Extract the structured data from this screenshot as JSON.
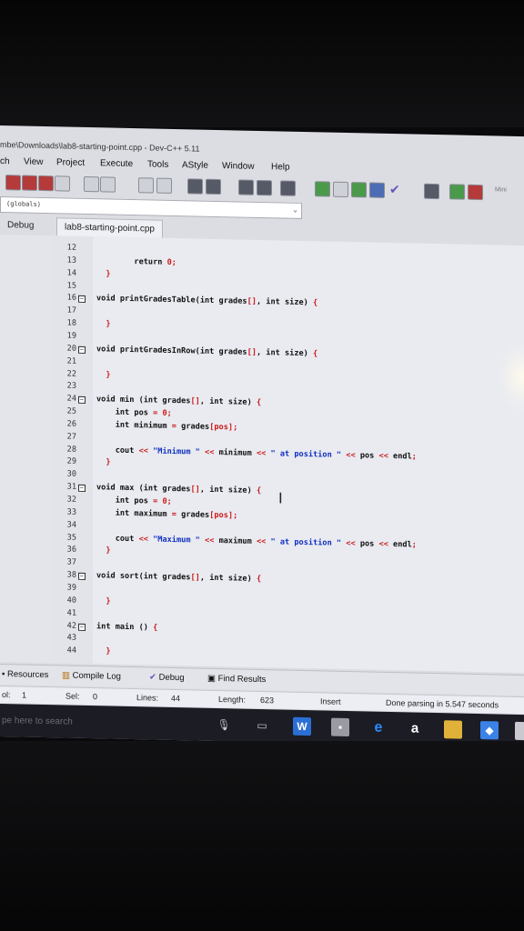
{
  "window": {
    "title": "mbe\\Downloads\\lab8-starting-point.cpp - Dev-C++ 5.11"
  },
  "menu": [
    "ch",
    "View",
    "Project",
    "Execute",
    "Tools",
    "AStyle",
    "Window",
    "Help"
  ],
  "toolbar": {
    "scope_combo": "(globals)",
    "right_label": "Mini"
  },
  "tabs": {
    "left": "Debug",
    "file": "lab8-starting-point.cpp"
  },
  "code": [
    {
      "n": "12",
      "fold": "",
      "parts": []
    },
    {
      "n": "13",
      "fold": "",
      "parts": [
        [
          "kw",
          "        return "
        ],
        [
          "num",
          "0"
        ],
        [
          "sym",
          ";"
        ]
      ]
    },
    {
      "n": "14",
      "fold": "",
      "parts": [
        [
          "sym",
          "  }"
        ]
      ]
    },
    {
      "n": "15",
      "fold": "",
      "parts": []
    },
    {
      "n": "16",
      "fold": "⊟",
      "parts": [
        [
          "kw",
          "void printGradesTable(int grades"
        ],
        [
          "sym",
          "[]"
        ],
        [
          "kw",
          ", int size) "
        ],
        [
          "sym",
          "{"
        ]
      ]
    },
    {
      "n": "17",
      "fold": "",
      "parts": []
    },
    {
      "n": "18",
      "fold": "",
      "parts": [
        [
          "sym",
          "  }"
        ]
      ]
    },
    {
      "n": "19",
      "fold": "",
      "parts": []
    },
    {
      "n": "20",
      "fold": "⊟",
      "parts": [
        [
          "kw",
          "void printGradesInRow(int grades"
        ],
        [
          "sym",
          "[]"
        ],
        [
          "kw",
          ", int size) "
        ],
        [
          "sym",
          "{"
        ]
      ]
    },
    {
      "n": "21",
      "fold": "",
      "parts": []
    },
    {
      "n": "22",
      "fold": "",
      "parts": [
        [
          "sym",
          "  }"
        ]
      ]
    },
    {
      "n": "23",
      "fold": "",
      "parts": []
    },
    {
      "n": "24",
      "fold": "⊟",
      "parts": [
        [
          "kw",
          "void min (int grades"
        ],
        [
          "sym",
          "[]"
        ],
        [
          "kw",
          ", int size) "
        ],
        [
          "sym",
          "{"
        ]
      ]
    },
    {
      "n": "25",
      "fold": "",
      "parts": [
        [
          "kw",
          "    int pos "
        ],
        [
          "sym",
          "= "
        ],
        [
          "num",
          "0"
        ],
        [
          "sym",
          ";"
        ]
      ]
    },
    {
      "n": "26",
      "fold": "",
      "parts": [
        [
          "kw",
          "    int minimum "
        ],
        [
          "sym",
          "= "
        ],
        [
          "kw",
          "grades"
        ],
        [
          "sym",
          "[pos];"
        ]
      ]
    },
    {
      "n": "27",
      "fold": "",
      "parts": []
    },
    {
      "n": "28",
      "fold": "",
      "parts": [
        [
          "kw",
          "    cout "
        ],
        [
          "sym",
          "<< "
        ],
        [
          "str",
          "\"Minimum \""
        ],
        [
          "sym",
          " << "
        ],
        [
          "kw",
          "minimum "
        ],
        [
          "sym",
          "<< "
        ],
        [
          "str",
          "\" at position \""
        ],
        [
          "sym",
          " << "
        ],
        [
          "kw",
          "pos "
        ],
        [
          "sym",
          "<< "
        ],
        [
          "kw",
          "endl"
        ],
        [
          "sym",
          ";"
        ]
      ]
    },
    {
      "n": "29",
      "fold": "",
      "parts": [
        [
          "sym",
          "  }"
        ]
      ]
    },
    {
      "n": "30",
      "fold": "",
      "parts": []
    },
    {
      "n": "31",
      "fold": "⊟",
      "parts": [
        [
          "kw",
          "void max (int grades"
        ],
        [
          "sym",
          "[]"
        ],
        [
          "kw",
          ", int size) "
        ],
        [
          "sym",
          "{"
        ]
      ]
    },
    {
      "n": "32",
      "fold": "",
      "parts": [
        [
          "kw",
          "    int pos "
        ],
        [
          "sym",
          "= "
        ],
        [
          "num",
          "0"
        ],
        [
          "sym",
          ";"
        ]
      ]
    },
    {
      "n": "33",
      "fold": "",
      "parts": [
        [
          "kw",
          "    int maximum "
        ],
        [
          "sym",
          "= "
        ],
        [
          "kw",
          "grades"
        ],
        [
          "sym",
          "[pos];"
        ]
      ]
    },
    {
      "n": "34",
      "fold": "",
      "parts": []
    },
    {
      "n": "35",
      "fold": "",
      "parts": [
        [
          "kw",
          "    cout "
        ],
        [
          "sym",
          "<< "
        ],
        [
          "str",
          "\"Maximum \""
        ],
        [
          "sym",
          " << "
        ],
        [
          "kw",
          "maximum "
        ],
        [
          "sym",
          "<< "
        ],
        [
          "str",
          "\" at position \""
        ],
        [
          "sym",
          " << "
        ],
        [
          "kw",
          "pos "
        ],
        [
          "sym",
          "<< "
        ],
        [
          "kw",
          "endl"
        ],
        [
          "sym",
          ";"
        ]
      ]
    },
    {
      "n": "36",
      "fold": "",
      "parts": [
        [
          "sym",
          "  }"
        ]
      ]
    },
    {
      "n": "37",
      "fold": "",
      "parts": []
    },
    {
      "n": "38",
      "fold": "⊟",
      "parts": [
        [
          "kw",
          "void sort(int grades"
        ],
        [
          "sym",
          "[]"
        ],
        [
          "kw",
          ", int size) "
        ],
        [
          "sym",
          "{"
        ]
      ]
    },
    {
      "n": "39",
      "fold": "",
      "parts": []
    },
    {
      "n": "40",
      "fold": "",
      "parts": [
        [
          "sym",
          "  }"
        ]
      ]
    },
    {
      "n": "41",
      "fold": "",
      "parts": []
    },
    {
      "n": "42",
      "fold": "⊟",
      "parts": [
        [
          "kw",
          "int main () "
        ],
        [
          "sym",
          "{"
        ]
      ]
    },
    {
      "n": "43",
      "fold": "",
      "parts": []
    },
    {
      "n": "44",
      "fold": "",
      "parts": [
        [
          "sym",
          "  }"
        ]
      ]
    }
  ],
  "bottom_tabs": [
    "Resources",
    "Compile Log",
    "Debug",
    "Find Results"
  ],
  "status": {
    "line_label": "ol:",
    "line_value": "1",
    "sel_label": "Sel:",
    "sel_value": "0",
    "lines_label": "Lines:",
    "lines_value": "44",
    "length_label": "Length:",
    "length_value": "623",
    "mode": "Insert",
    "message": "Done parsing in 5.547 seconds"
  },
  "taskbar": {
    "search_placeholder": "pe here to search"
  },
  "colors": {
    "keyword": "#111111",
    "string": "#1030c0",
    "number": "#cc1a1a",
    "editor_bg": "#e9ebf1"
  }
}
